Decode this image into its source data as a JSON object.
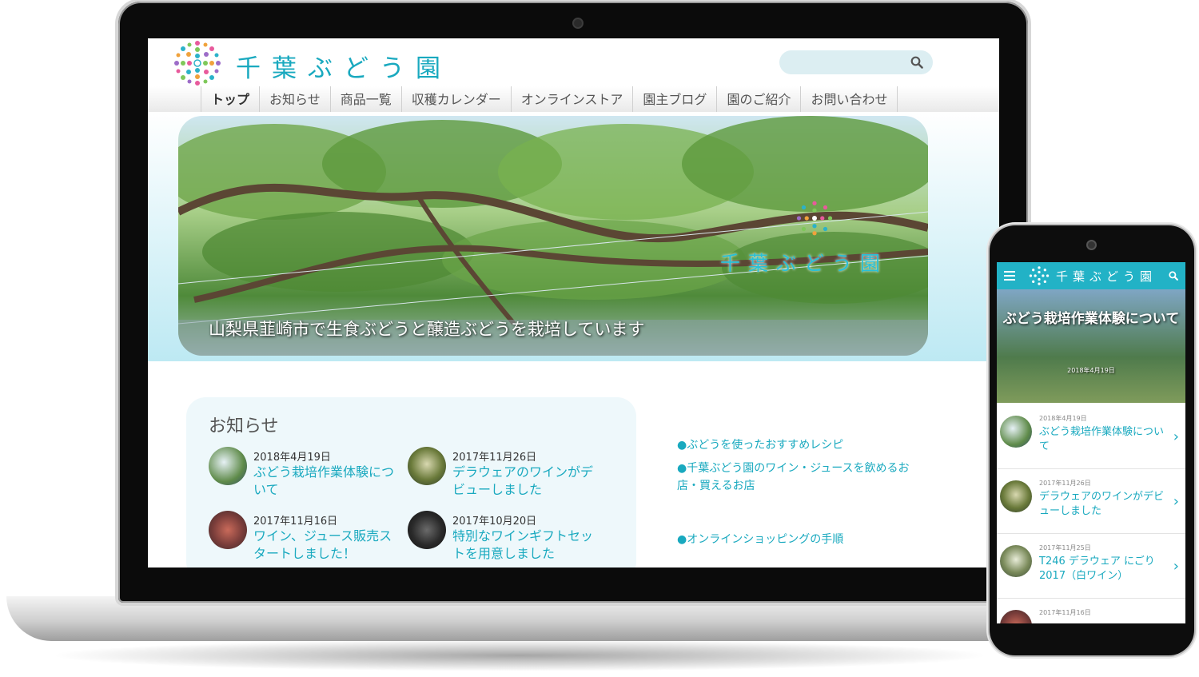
{
  "desktop": {
    "site_title": "千葉ぶどう園",
    "search": {
      "placeholder": ""
    },
    "nav": [
      {
        "label": "トップ"
      },
      {
        "label": "お知らせ"
      },
      {
        "label": "商品一覧"
      },
      {
        "label": "収穫カレンダー"
      },
      {
        "label": "オンラインストア"
      },
      {
        "label": "園主ブログ"
      },
      {
        "label": "園のご紹介"
      },
      {
        "label": "お問い合わせ"
      }
    ],
    "hero": {
      "caption": "山梨県韮崎市で生食ぶどうと醸造ぶどうを栽培しています",
      "logo_text": "千葉ぶどう園"
    },
    "news": {
      "heading": "お知らせ",
      "items": [
        {
          "date": "2018年4月19日",
          "title": "ぶどう栽培作業体験について"
        },
        {
          "date": "2017年11月26日",
          "title": "デラウェアのワインがデビューしました"
        },
        {
          "date": "2017年11月16日",
          "title": "ワイン、ジュース販売スタートしました！"
        },
        {
          "date": "2017年10月20日",
          "title": "特別なワインギフトセットを用意しました"
        }
      ]
    },
    "links": [
      {
        "label": "●ぶどうを使ったおすすめレシピ"
      },
      {
        "label": "●千葉ぶどう園のワイン・ジュースを飲めるお店・買えるお店"
      },
      {
        "label": "●オンラインショッピングの手順"
      }
    ]
  },
  "mobile": {
    "site_title": "千葉ぶどう園",
    "hero": {
      "title": "ぶどう栽培作業体験について",
      "date": "2018年4月19日"
    },
    "items": [
      {
        "date": "2018年4月19日",
        "title": "ぶどう栽培作業体験について"
      },
      {
        "date": "2017年11月26日",
        "title": "デラウェアのワインがデビューしました"
      },
      {
        "date": "2017年11月25日",
        "title": "T246 デラウェア にごり 2017（白ワイン）"
      },
      {
        "date": "2017年11月16日",
        "title": ""
      }
    ]
  },
  "colors": {
    "accent": "#19a9bf",
    "mobile_header": "#22b2c6",
    "news_bg": "#eef8fb"
  }
}
